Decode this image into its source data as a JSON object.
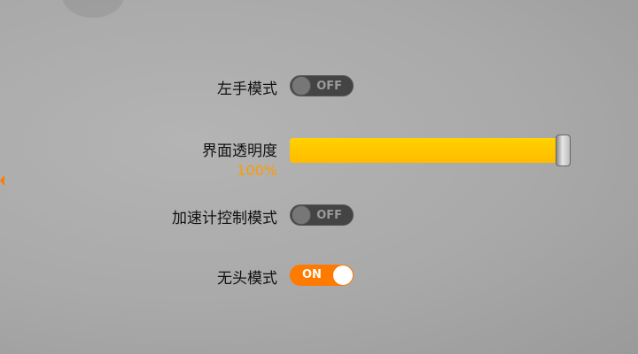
{
  "settings": {
    "left_hand_mode": {
      "label": "左手模式",
      "state": "OFF",
      "on": false
    },
    "opacity": {
      "label": "界面透明度",
      "value_text": "100%",
      "value": 100
    },
    "accelerometer_mode": {
      "label": "加速计控制模式",
      "state": "OFF",
      "on": false
    },
    "headless_mode": {
      "label": "无头模式",
      "state": "ON",
      "on": true
    }
  },
  "colors": {
    "accent": "#ff7a00",
    "slider": "#ffc400",
    "percent": "#ff9a00"
  }
}
